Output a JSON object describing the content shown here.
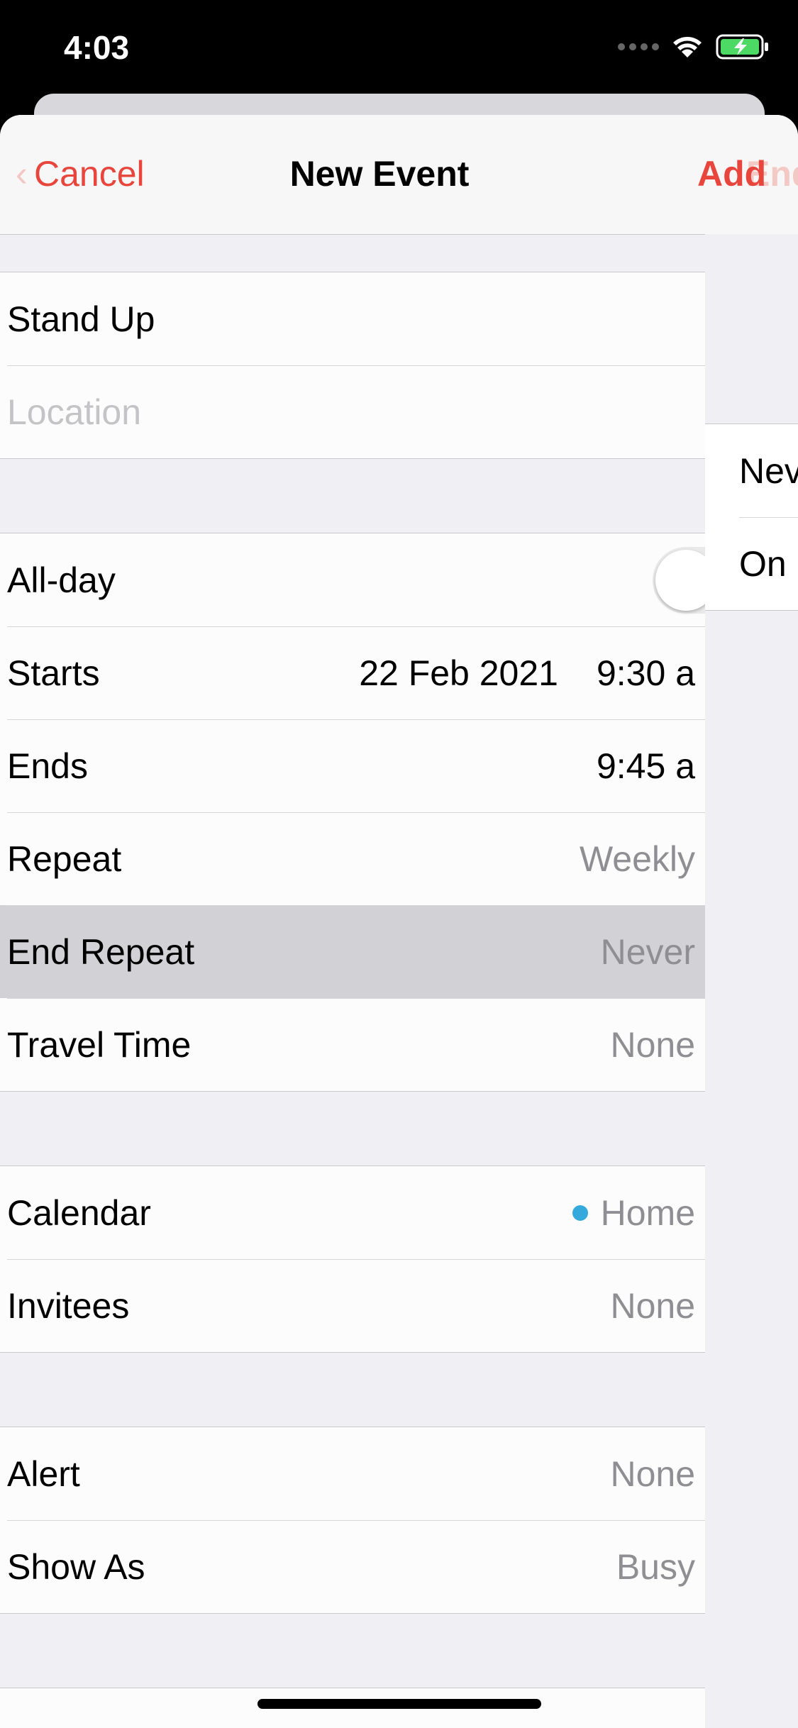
{
  "status_bar": {
    "time": "4:03",
    "battery_color": "#4cd964"
  },
  "navbar": {
    "cancel_label": "Cancel",
    "title": "New Event",
    "add_label": "Add",
    "ghost_label": "End"
  },
  "event": {
    "title": "Stand Up",
    "location_placeholder": "Location",
    "all_day_label": "All-day",
    "all_day_on": false,
    "starts_label": "Starts",
    "starts_date": "22 Feb 2021",
    "starts_time": "9:30 a",
    "ends_label": "Ends",
    "ends_time": "9:45 a",
    "repeat_label": "Repeat",
    "repeat_value": "Weekly",
    "end_repeat_label": "End Repeat",
    "end_repeat_value": "Never",
    "travel_time_label": "Travel Time",
    "travel_time_value": "None",
    "calendar_label": "Calendar",
    "calendar_value": "Home",
    "calendar_color": "#34aadc",
    "invitees_label": "Invitees",
    "invitees_value": "None",
    "alert_label": "Alert",
    "alert_value": "None",
    "show_as_label": "Show As",
    "show_as_value": "Busy"
  },
  "end_repeat_panel": {
    "options": [
      "Never",
      "On Date"
    ]
  },
  "colors": {
    "accent": "#e8453c",
    "selected_row": "#d1d1d6"
  }
}
